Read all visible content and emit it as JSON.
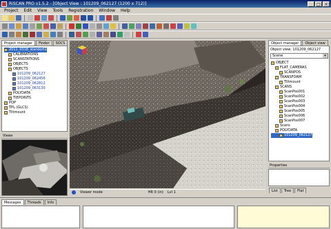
{
  "window": {
    "title": "RiSCAN PRO v1.5.2 - [Object View : 101209_062127 (1200 x 712)]",
    "controls": [
      "_",
      "□",
      "×"
    ]
  },
  "menu": [
    "Project",
    "Edit",
    "View",
    "Tools",
    "Registration",
    "Window",
    "Help"
  ],
  "project_panel": {
    "tabs": [
      "Project manager",
      "Finder",
      "SOCS"
    ],
    "tree": [
      {
        "label": "2011_0318_standort1",
        "indent": 0,
        "selected": true
      },
      {
        "label": "CALIBRATIONS",
        "indent": 1
      },
      {
        "label": "SCANSTATIONS",
        "indent": 1
      },
      {
        "label": "OBJECTS",
        "indent": 1
      },
      {
        "label": "OBJECTS",
        "indent": 1
      },
      {
        "label": "101209_062127",
        "indent": 2,
        "highlight": true
      },
      {
        "label": "101209_062456",
        "indent": 2,
        "highlight": true
      },
      {
        "label": "101209_062812",
        "indent": 2,
        "highlight": true
      },
      {
        "label": "101209_063130",
        "indent": 2,
        "highlight": true
      },
      {
        "label": "POLYDATA",
        "indent": 1
      },
      {
        "label": "TIEPOINTS",
        "indent": 1
      },
      {
        "label": "POP",
        "indent": 0
      },
      {
        "label": "TPL (GLCS)",
        "indent": 0
      },
      {
        "label": "Tiltmount",
        "indent": 0
      }
    ]
  },
  "views_panel": {
    "title": "Views"
  },
  "right_panel": {
    "tabs": [
      "Object manager",
      "Object view"
    ],
    "header": "Object view: 101209_062127",
    "dropdown": "Scene",
    "tree": [
      {
        "label": "OBJECT",
        "indent": 0
      },
      {
        "label": "FLAT_CAMERAS",
        "indent": 1
      },
      {
        "label": "SCANPOS",
        "indent": 2
      },
      {
        "label": "TRANSFORM",
        "indent": 1
      },
      {
        "label": "Tiltmount",
        "indent": 2
      },
      {
        "label": "SCANS",
        "indent": 1
      },
      {
        "label": "ScanPos001",
        "indent": 2
      },
      {
        "label": "ScanPos002",
        "indent": 2
      },
      {
        "label": "ScanPos003",
        "indent": 2
      },
      {
        "label": "ScanPos004",
        "indent": 2
      },
      {
        "label": "ScanPos005",
        "indent": 2
      },
      {
        "label": "ScanPos006",
        "indent": 2
      },
      {
        "label": "ScanPos007",
        "indent": 2
      },
      {
        "label": "Scans",
        "indent": 1
      },
      {
        "label": "POLYDATA",
        "indent": 1
      },
      {
        "label": "101209_062127",
        "indent": 2,
        "selected": true
      }
    ],
    "properties_title": "Properties",
    "prop_tabs": [
      "List",
      "Tree",
      "Flat"
    ]
  },
  "status": {
    "icon": "info-icon",
    "mode": "Viewer mode",
    "coords": "HR 0 (in)",
    "level": "Lvl 1"
  },
  "bottom": {
    "tabs": [
      "Messages",
      "Threads",
      "Info"
    ]
  },
  "colors": {
    "titlebar": "#0a246a",
    "selection": "#316ac5",
    "highlight_text": "#1a3cc0",
    "note_panel": "#fffbd6"
  }
}
